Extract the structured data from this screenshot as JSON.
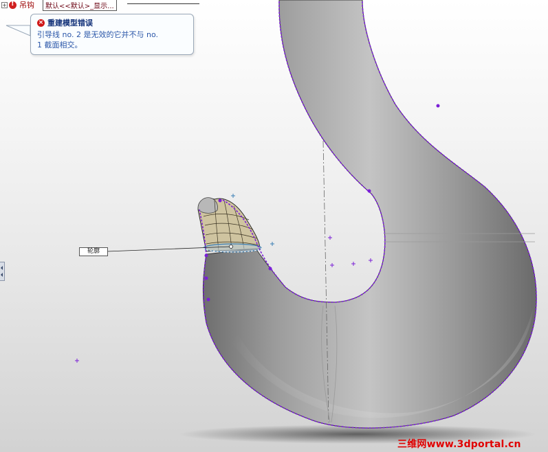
{
  "feature_tree": {
    "expand_symbol": "+",
    "part_name": "吊钩",
    "config_label": "默认<<默认>_显示..."
  },
  "error_balloon": {
    "title": "重建模型错误",
    "message_line1": "引导线 no. 2 是无效的它并不与 no.",
    "message_line2": "1 截面相交。",
    "icon": "error-x-icon"
  },
  "callout": {
    "label": "轮廓"
  },
  "watermark": {
    "text": "三维网www.3dportal.cn"
  },
  "colors": {
    "model_gray": "#8f8f8f",
    "guide_curve": "#7a1fd6",
    "error_red": "#d01818",
    "watermark_red": "#e00000",
    "balloon_text": "#2a56a8"
  }
}
